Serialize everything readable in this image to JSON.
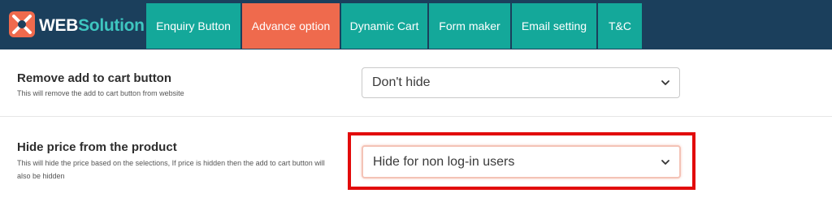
{
  "brand": {
    "prefix": "WEB",
    "suffix": "Solution"
  },
  "tabs": [
    {
      "label": "Enquiry Button",
      "active": false
    },
    {
      "label": "Advance option",
      "active": true
    },
    {
      "label": "Dynamic Cart",
      "active": false
    },
    {
      "label": "Form maker",
      "active": false
    },
    {
      "label": "Email setting",
      "active": false
    },
    {
      "label": "T&C",
      "active": false
    }
  ],
  "settings": [
    {
      "label": "Remove add to cart button",
      "description": "This will remove the add to cart button from website",
      "selected": "Don't hide"
    },
    {
      "label": "Hide price from the product",
      "description": "This will hide the price based on the selections, If price is hidden then the add to cart button will also be hidden",
      "selected": "Hide for non log-in users"
    }
  ],
  "colors": {
    "topbar": "#1b3f5c",
    "tab": "#14a89a",
    "tab_active": "#ef6a4d",
    "highlight": "#e20b0b"
  },
  "icons": {
    "logo": "websolution-logo-icon",
    "dropdown": "chevron-down-icon"
  }
}
